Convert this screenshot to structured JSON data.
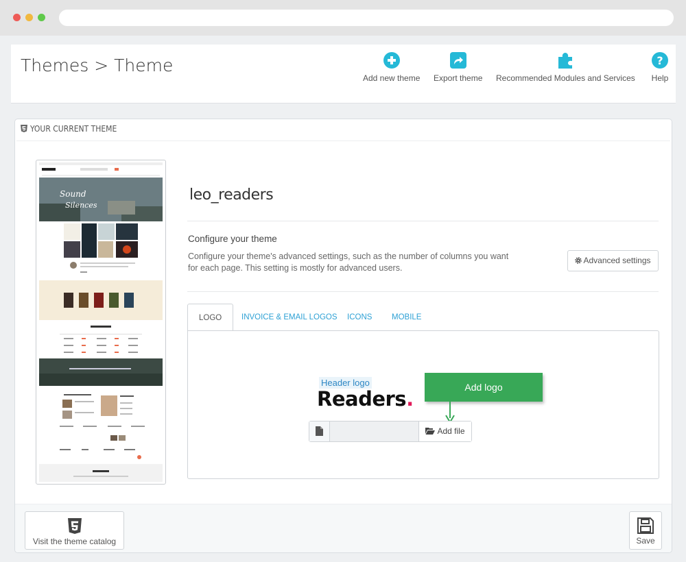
{
  "header": {
    "title": "Themes > Theme",
    "toolbar": [
      {
        "label": "Add new theme",
        "icon": "add-circle-icon"
      },
      {
        "label": "Export theme",
        "icon": "export-icon"
      },
      {
        "label": "Recommended Modules and Services",
        "icon": "puzzle-icon"
      },
      {
        "label": "Help",
        "icon": "help-icon"
      }
    ]
  },
  "panel": {
    "heading": "YOUR CURRENT THEME",
    "theme_name": "leo_readers",
    "configure_title": "Configure your theme",
    "configure_desc": "Configure your theme's advanced settings, such as the number of columns you want for each page. This setting is mostly for advanced users.",
    "advanced_label": "Advanced settings",
    "tabs": [
      "LOGO",
      "INVOICE & EMAIL LOGOS",
      "ICONS",
      "MOBILE"
    ],
    "active_tab": "LOGO",
    "logo": {
      "label": "Header logo",
      "logo_text": "Readers",
      "logo_dot": ".",
      "callout": "Add logo",
      "file_value": "",
      "add_file_label": "Add file"
    },
    "footer": {
      "catalog_label": "Visit the theme catalog",
      "save_label": "Save"
    }
  },
  "colors": {
    "accent": "#25b9d7",
    "tab_link": "#2ea1d5",
    "callout_green": "#38a857",
    "logo_dot": "#e11c5b"
  }
}
